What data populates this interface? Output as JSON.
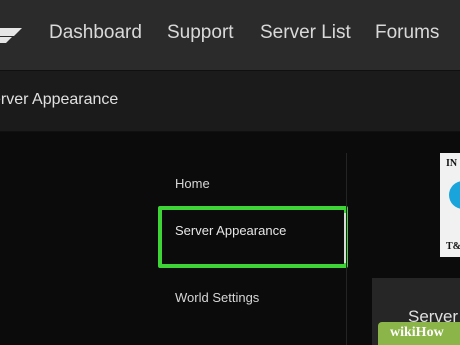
{
  "header": {
    "logo_icon": "brand-logo-icon",
    "nav": [
      {
        "label": "Dashboard"
      },
      {
        "label": "Support"
      },
      {
        "label": "Server List"
      },
      {
        "label": "Forums"
      }
    ]
  },
  "breadcrumb": {
    "text": "erver Appearance"
  },
  "sidebar": {
    "items": [
      {
        "label": "Home"
      },
      {
        "label": "Server Appearance",
        "active": true
      },
      {
        "label": "World Settings"
      }
    ]
  },
  "thumbnail": {
    "top_text": "IN",
    "bottom_text": "T&"
  },
  "content": {
    "title": "Server"
  },
  "watermark": {
    "text": "wikiHow"
  },
  "colors": {
    "highlight": "#3ed437",
    "thumb_accent": "#1aa4dc",
    "watermark_bg": "#8bb548"
  }
}
